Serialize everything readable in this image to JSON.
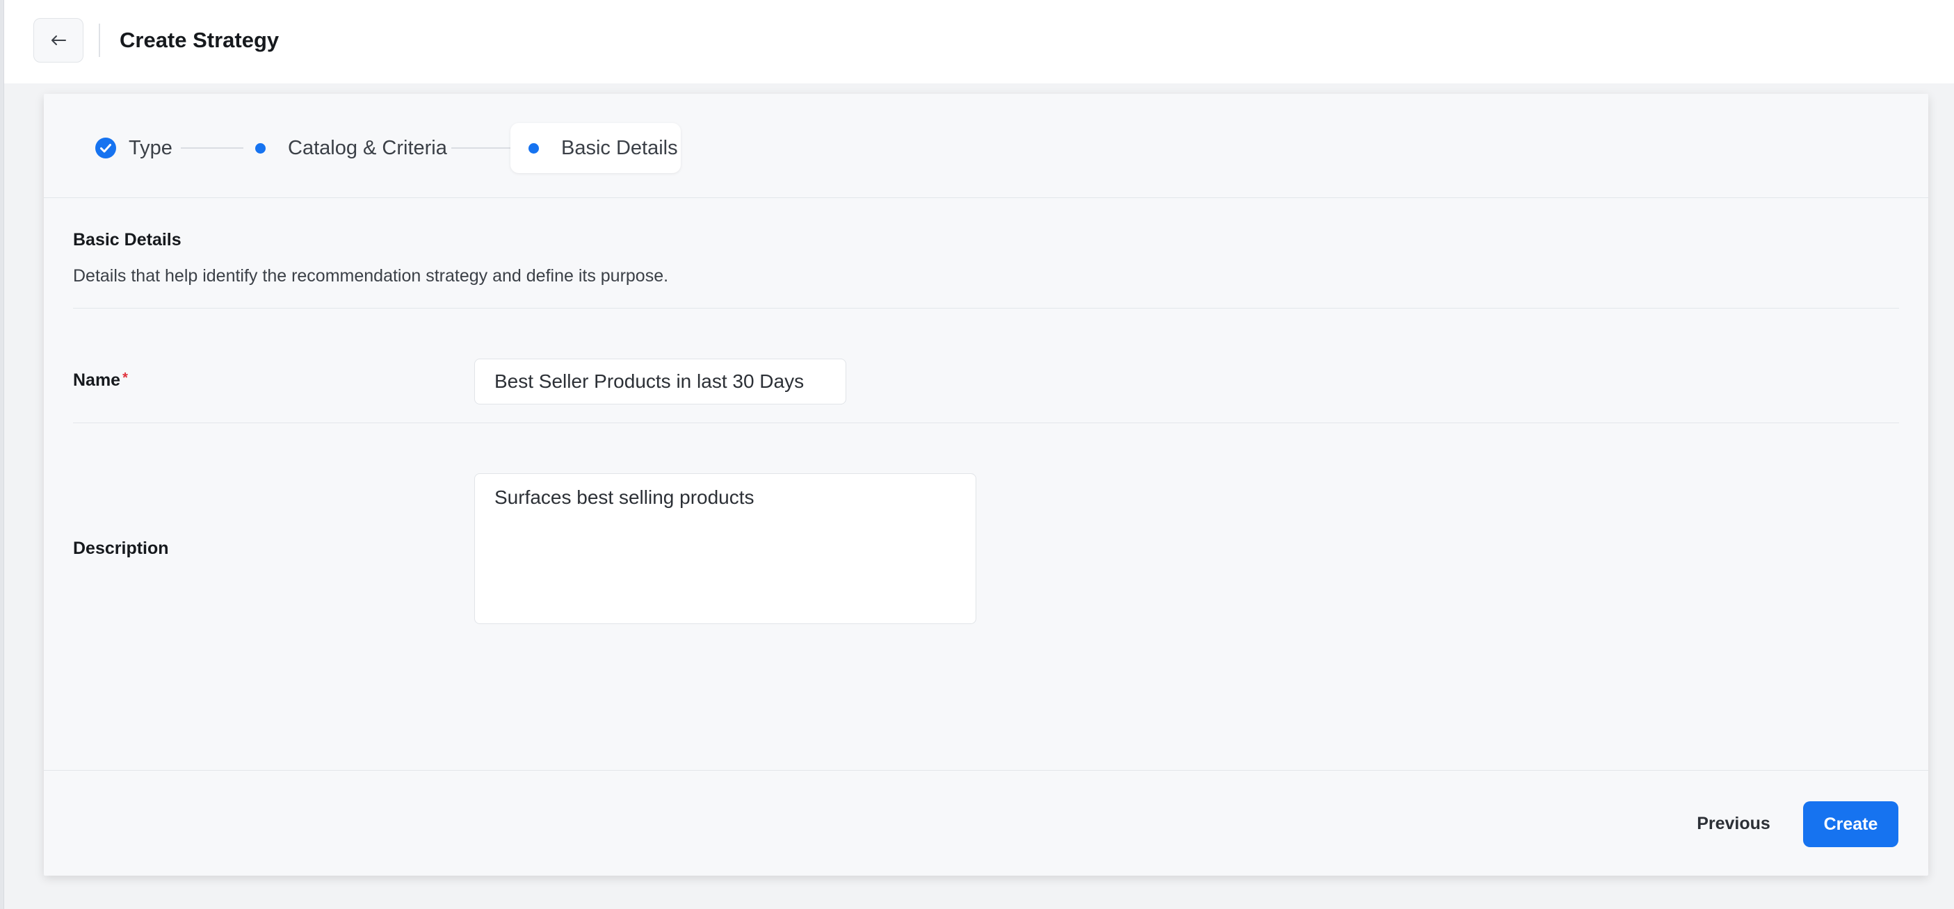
{
  "header": {
    "title": "Create Strategy",
    "back_icon": "arrow-left-icon"
  },
  "stepper": {
    "steps": [
      {
        "label": "Type",
        "status": "completed",
        "icon": "check-circle-icon"
      },
      {
        "label": "Catalog & Criteria",
        "status": "visited",
        "icon": "dot-icon"
      },
      {
        "label": "Basic Details",
        "status": "active",
        "icon": "dot-icon"
      }
    ]
  },
  "section": {
    "title": "Basic Details",
    "description": "Details that help identify the recommendation strategy and define its purpose."
  },
  "form": {
    "name": {
      "label": "Name",
      "required_marker": "*",
      "value": "Best Seller Products in last 30 Days"
    },
    "description": {
      "label": "Description",
      "value": "Surfaces best selling products"
    }
  },
  "footer": {
    "previous_label": "Previous",
    "create_label": "Create"
  },
  "colors": {
    "accent": "#1673f0",
    "required": "#e0323c",
    "card_bg": "#f7f8fa"
  }
}
